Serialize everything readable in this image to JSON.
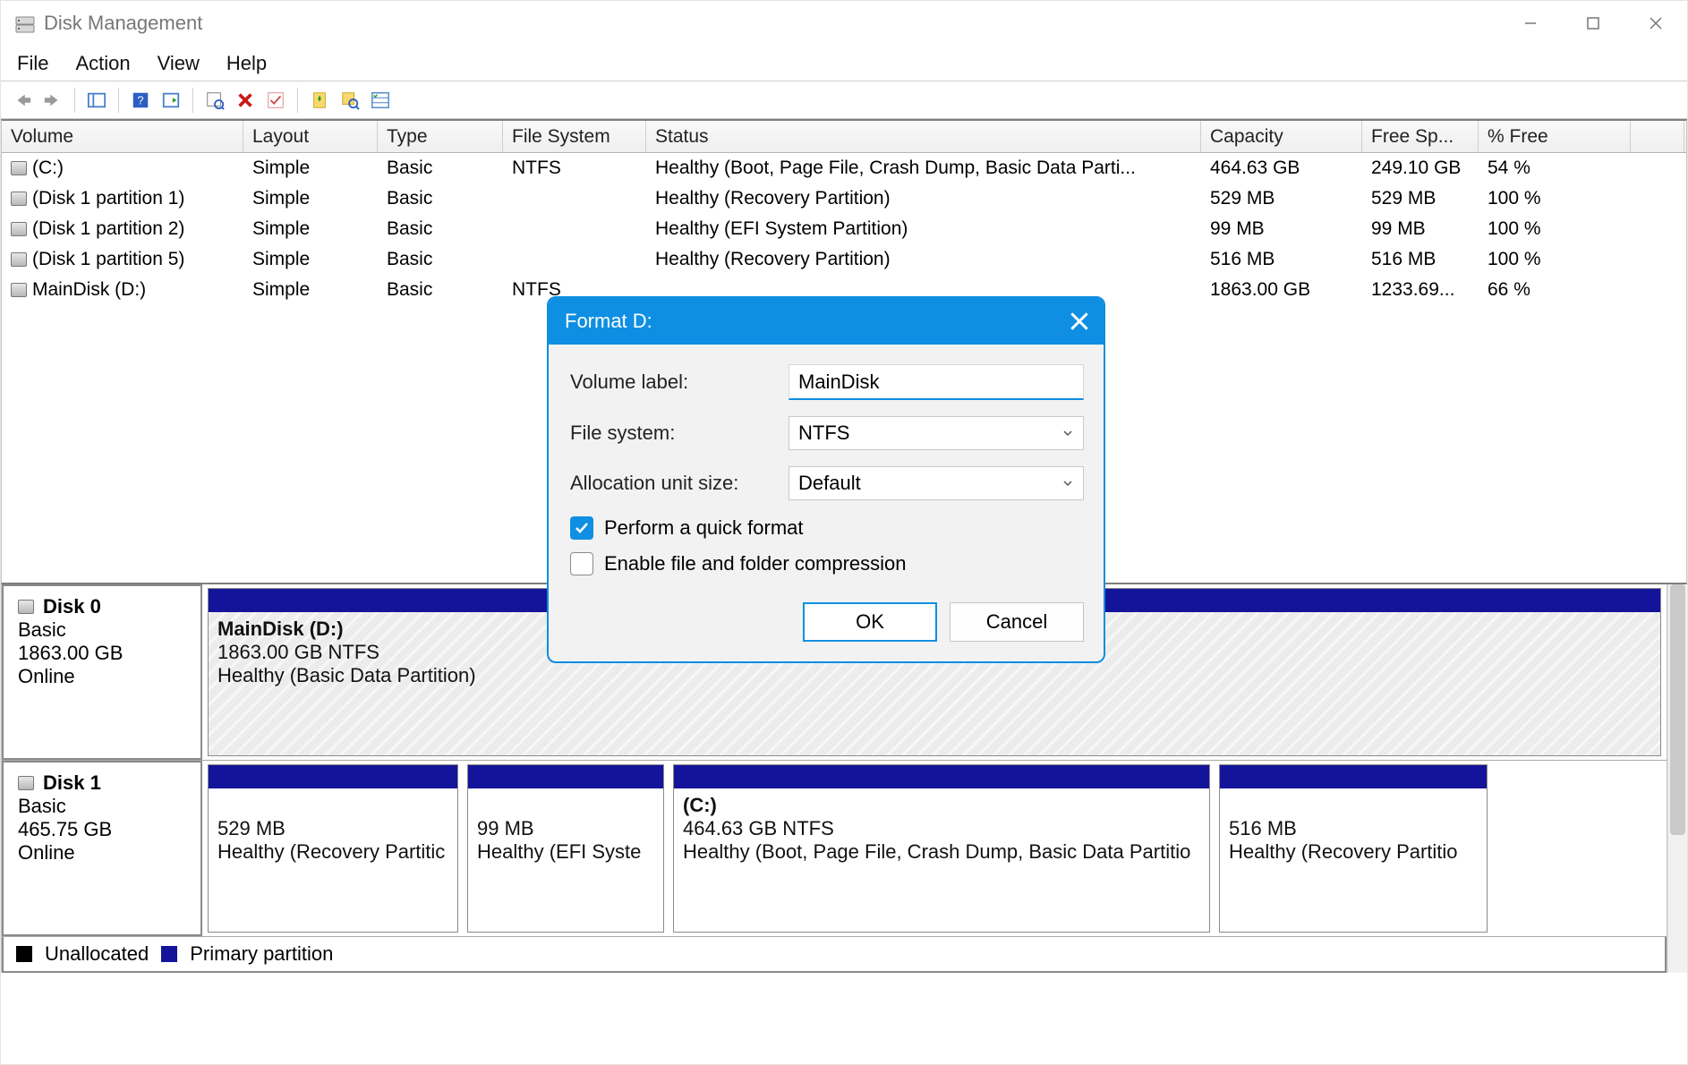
{
  "window": {
    "title": "Disk Management"
  },
  "menubar": {
    "file": "File",
    "action": "Action",
    "view": "View",
    "help": "Help"
  },
  "vol_header": {
    "volume": "Volume",
    "layout": "Layout",
    "type": "Type",
    "fs": "File System",
    "status": "Status",
    "capacity": "Capacity",
    "free": "Free Sp...",
    "pct": "% Free"
  },
  "volumes": [
    {
      "name": "(C:)",
      "layout": "Simple",
      "type": "Basic",
      "fs": "NTFS",
      "status": "Healthy (Boot, Page File, Crash Dump, Basic Data Parti...",
      "capacity": "464.63 GB",
      "free": "249.10 GB",
      "pct": "54 %"
    },
    {
      "name": "(Disk 1 partition 1)",
      "layout": "Simple",
      "type": "Basic",
      "fs": "",
      "status": "Healthy (Recovery Partition)",
      "capacity": "529 MB",
      "free": "529 MB",
      "pct": "100 %"
    },
    {
      "name": "(Disk 1 partition 2)",
      "layout": "Simple",
      "type": "Basic",
      "fs": "",
      "status": "Healthy (EFI System Partition)",
      "capacity": "99 MB",
      "free": "99 MB",
      "pct": "100 %"
    },
    {
      "name": "(Disk 1 partition 5)",
      "layout": "Simple",
      "type": "Basic",
      "fs": "",
      "status": "Healthy (Recovery Partition)",
      "capacity": "516 MB",
      "free": "516 MB",
      "pct": "100 %"
    },
    {
      "name": "MainDisk (D:)",
      "layout": "Simple",
      "type": "Basic",
      "fs": "NTFS",
      "status": "",
      "capacity": "1863.00 GB",
      "free": "1233.69...",
      "pct": "66 %"
    }
  ],
  "disks": {
    "disk0": {
      "title": "Disk 0",
      "type": "Basic",
      "size": "1863.00 GB",
      "state": "Online",
      "block": {
        "label": "MainDisk  (D:)",
        "line2": "1863.00 GB NTFS",
        "line3": "Healthy (Basic Data Partition)"
      }
    },
    "disk1": {
      "title": "Disk 1",
      "type": "Basic",
      "size": "465.75 GB",
      "state": "Online",
      "blocks": [
        {
          "label": "",
          "line2": "529 MB",
          "line3": "Healthy (Recovery Partitic"
        },
        {
          "label": "",
          "line2": "99 MB",
          "line3": "Healthy (EFI Syste"
        },
        {
          "label": "(C:)",
          "line2": "464.63 GB NTFS",
          "line3": "Healthy (Boot, Page File, Crash Dump, Basic Data Partitio"
        },
        {
          "label": "",
          "line2": "516 MB",
          "line3": "Healthy (Recovery Partitio"
        }
      ]
    }
  },
  "legend": {
    "unalloc": "Unallocated",
    "primary": "Primary partition"
  },
  "dialog": {
    "title": "Format D:",
    "volume_label_lbl": "Volume label:",
    "volume_label_val": "MainDisk",
    "fs_lbl": "File system:",
    "fs_val": "NTFS",
    "alloc_lbl": "Allocation unit size:",
    "alloc_val": "Default",
    "quick": "Perform a quick format",
    "compress": "Enable file and folder compression",
    "ok": "OK",
    "cancel": "Cancel"
  }
}
